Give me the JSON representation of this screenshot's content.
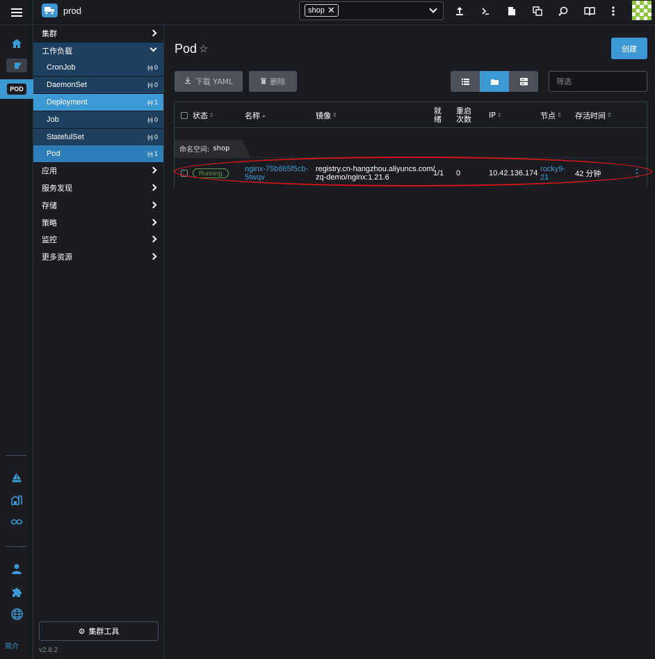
{
  "header": {
    "cluster_name": "prod",
    "namespace_chip": "shop",
    "icons": [
      "upload-icon",
      "terminal-icon",
      "file-icon",
      "copy-icon",
      "search-icon",
      "book-icon",
      "more-vertical-icon"
    ]
  },
  "rail": {
    "pod_badge": "POD",
    "about": "简介"
  },
  "sidenav": {
    "groups": {
      "cluster": "集群",
      "workload": "工作负载",
      "apps": "应用",
      "service_discovery": "服务发现",
      "storage": "存储",
      "policy": "策略",
      "monitoring": "监控",
      "more": "更多资源"
    },
    "workload_items": [
      {
        "label": "CronJob",
        "count": "0"
      },
      {
        "label": "DaemonSet",
        "count": "0"
      },
      {
        "label": "Deployment",
        "count": "1"
      },
      {
        "label": "Job",
        "count": "0"
      },
      {
        "label": "StatefulSet",
        "count": "0"
      },
      {
        "label": "Pod",
        "count": "1"
      }
    ],
    "cluster_tools": "集群工具",
    "version": "v2.8.2"
  },
  "main": {
    "title": "Pod",
    "create_label": "创建",
    "download_yaml": "下载 YAML",
    "delete_label": "删除",
    "filter_placeholder": "筛选",
    "columns": {
      "status": "状态",
      "name": "名称",
      "image": "镜像",
      "ready_1": "就",
      "ready_2": "绪",
      "restarts_1": "重启",
      "restarts_2": "次数",
      "ip": "IP",
      "node": "节点",
      "age": "存活时间"
    },
    "group": {
      "label": "命名空间:",
      "value": "shop"
    },
    "rows": [
      {
        "status": "Running",
        "name_1": "nginx-75b865f5cb-",
        "name_2": "5twqv",
        "image_1": "registry.cn-hangzhou.aliyuncs.com/",
        "image_2": "zq-demo/nginx:1.21.6",
        "ready": "1/1",
        "restarts": "0",
        "ip": "10.42.136.174",
        "node_1": "rocky9-",
        "node_2": "21",
        "age": "42 分钟"
      }
    ]
  },
  "colors": {
    "accent": "#3d98d3",
    "background": "#1b1c21",
    "running": "#5d9a4c",
    "annotation": "#d0161c"
  }
}
